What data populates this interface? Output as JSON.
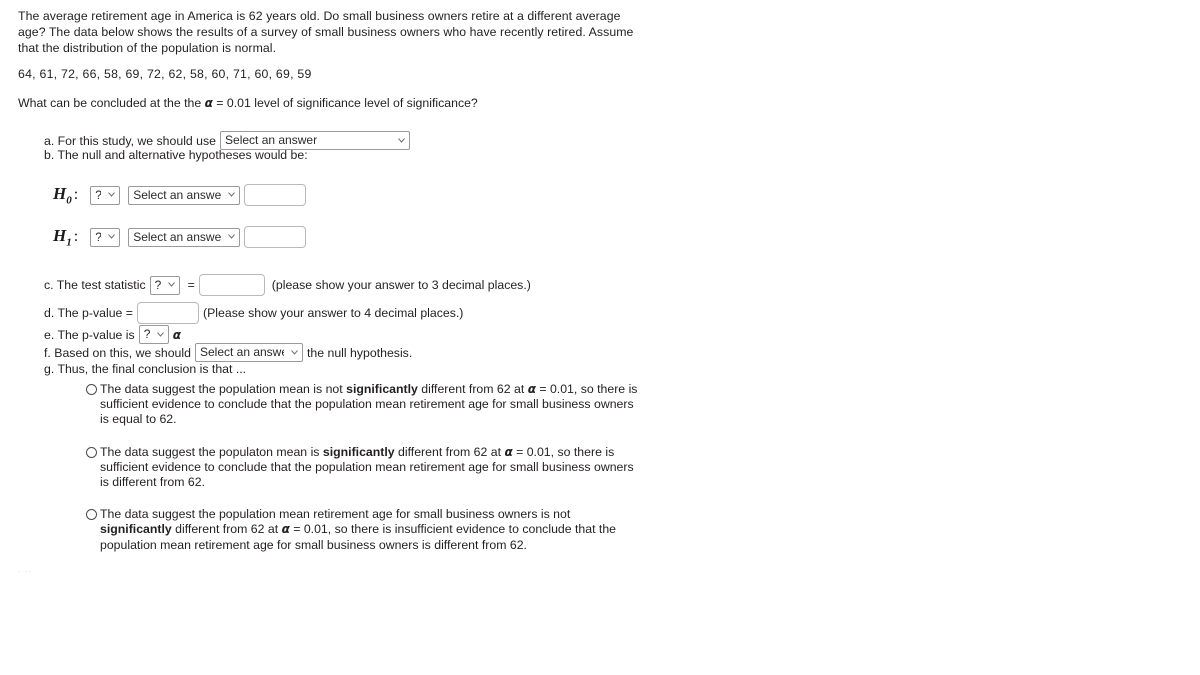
{
  "problem": {
    "intro": "The average retirement age in America is 62 years old. Do small business owners retire at a different average age? The data below shows the results of a survey of small business owners who have recently retired. Assume that the distribution of the population is normal.",
    "data_values": "64, 61, 72, 66, 58, 69, 72, 62, 58, 60, 71, 60, 69, 59",
    "conclude_prefix": "What can be concluded at the the ",
    "alpha_symbol": "α",
    "conclude_suffix": " = 0.01 level of significance level of significance?",
    "significance_level": "0.01",
    "population_mean": "62"
  },
  "items": {
    "a": {
      "label": "a. For this study, we should use",
      "select_value": "Select an answer"
    },
    "b": {
      "label": "b. The null and alternative hypotheses would be:",
      "hypotheses": [
        {
          "symbol": "H",
          "subscript": "0",
          "colon": ":",
          "operator_value": "?",
          "answer_value": "Select an answer",
          "input_value": ""
        },
        {
          "symbol": "H",
          "subscript": "1",
          "colon": ":",
          "operator_value": "?",
          "answer_value": "Select an answer",
          "input_value": ""
        }
      ]
    },
    "c": {
      "label": "c. The test statistic",
      "select_value": "?",
      "equals": "=",
      "input_value": "",
      "hint": "(please show your answer to 3 decimal places.)"
    },
    "d": {
      "label": "d. The p-value =",
      "input_value": "",
      "hint": "(Please show your answer to 4 decimal places.)"
    },
    "e": {
      "label": "e. The p-value is",
      "select_value": "?",
      "alpha": "α"
    },
    "f": {
      "label_before": "f. Based on this, we should",
      "select_value": "Select an answer",
      "label_after": "the null hypothesis."
    },
    "g": {
      "label": "g. Thus, the final conclusion is that ..."
    }
  },
  "options": [
    {
      "part1": "The data suggest the population mean is not ",
      "bold": "significantly",
      "part2": " different from 62 at ",
      "alpha": "α",
      "part3": " = 0.01, so there is sufficient evidence to conclude that the population mean retirement age for small business owners is equal to 62.",
      "selected": false
    },
    {
      "part1": "The data suggest the populaton mean is ",
      "bold": "significantly",
      "part2": " different from 62 at ",
      "alpha": "α",
      "part3": " = 0.01, so there is sufficient evidence to conclude that the population mean retirement age for small business owners is different from 62.",
      "selected": false
    },
    {
      "part1": "The data suggest the population mean retirement age for small business owners is not ",
      "bold": "significantly",
      "part2": " different from 62 at ",
      "alpha": "α",
      "part3": " = 0.01, so there is insufficient evidence to conclude that the population mean retirement age for small business owners is different from 62.",
      "selected": false
    }
  ],
  "artifact": {
    "text": ". .."
  },
  "colors": {
    "text": "#231f20",
    "border": "#9a9a9a",
    "input_border": "#b9b9b9",
    "background": "#ffffff"
  }
}
